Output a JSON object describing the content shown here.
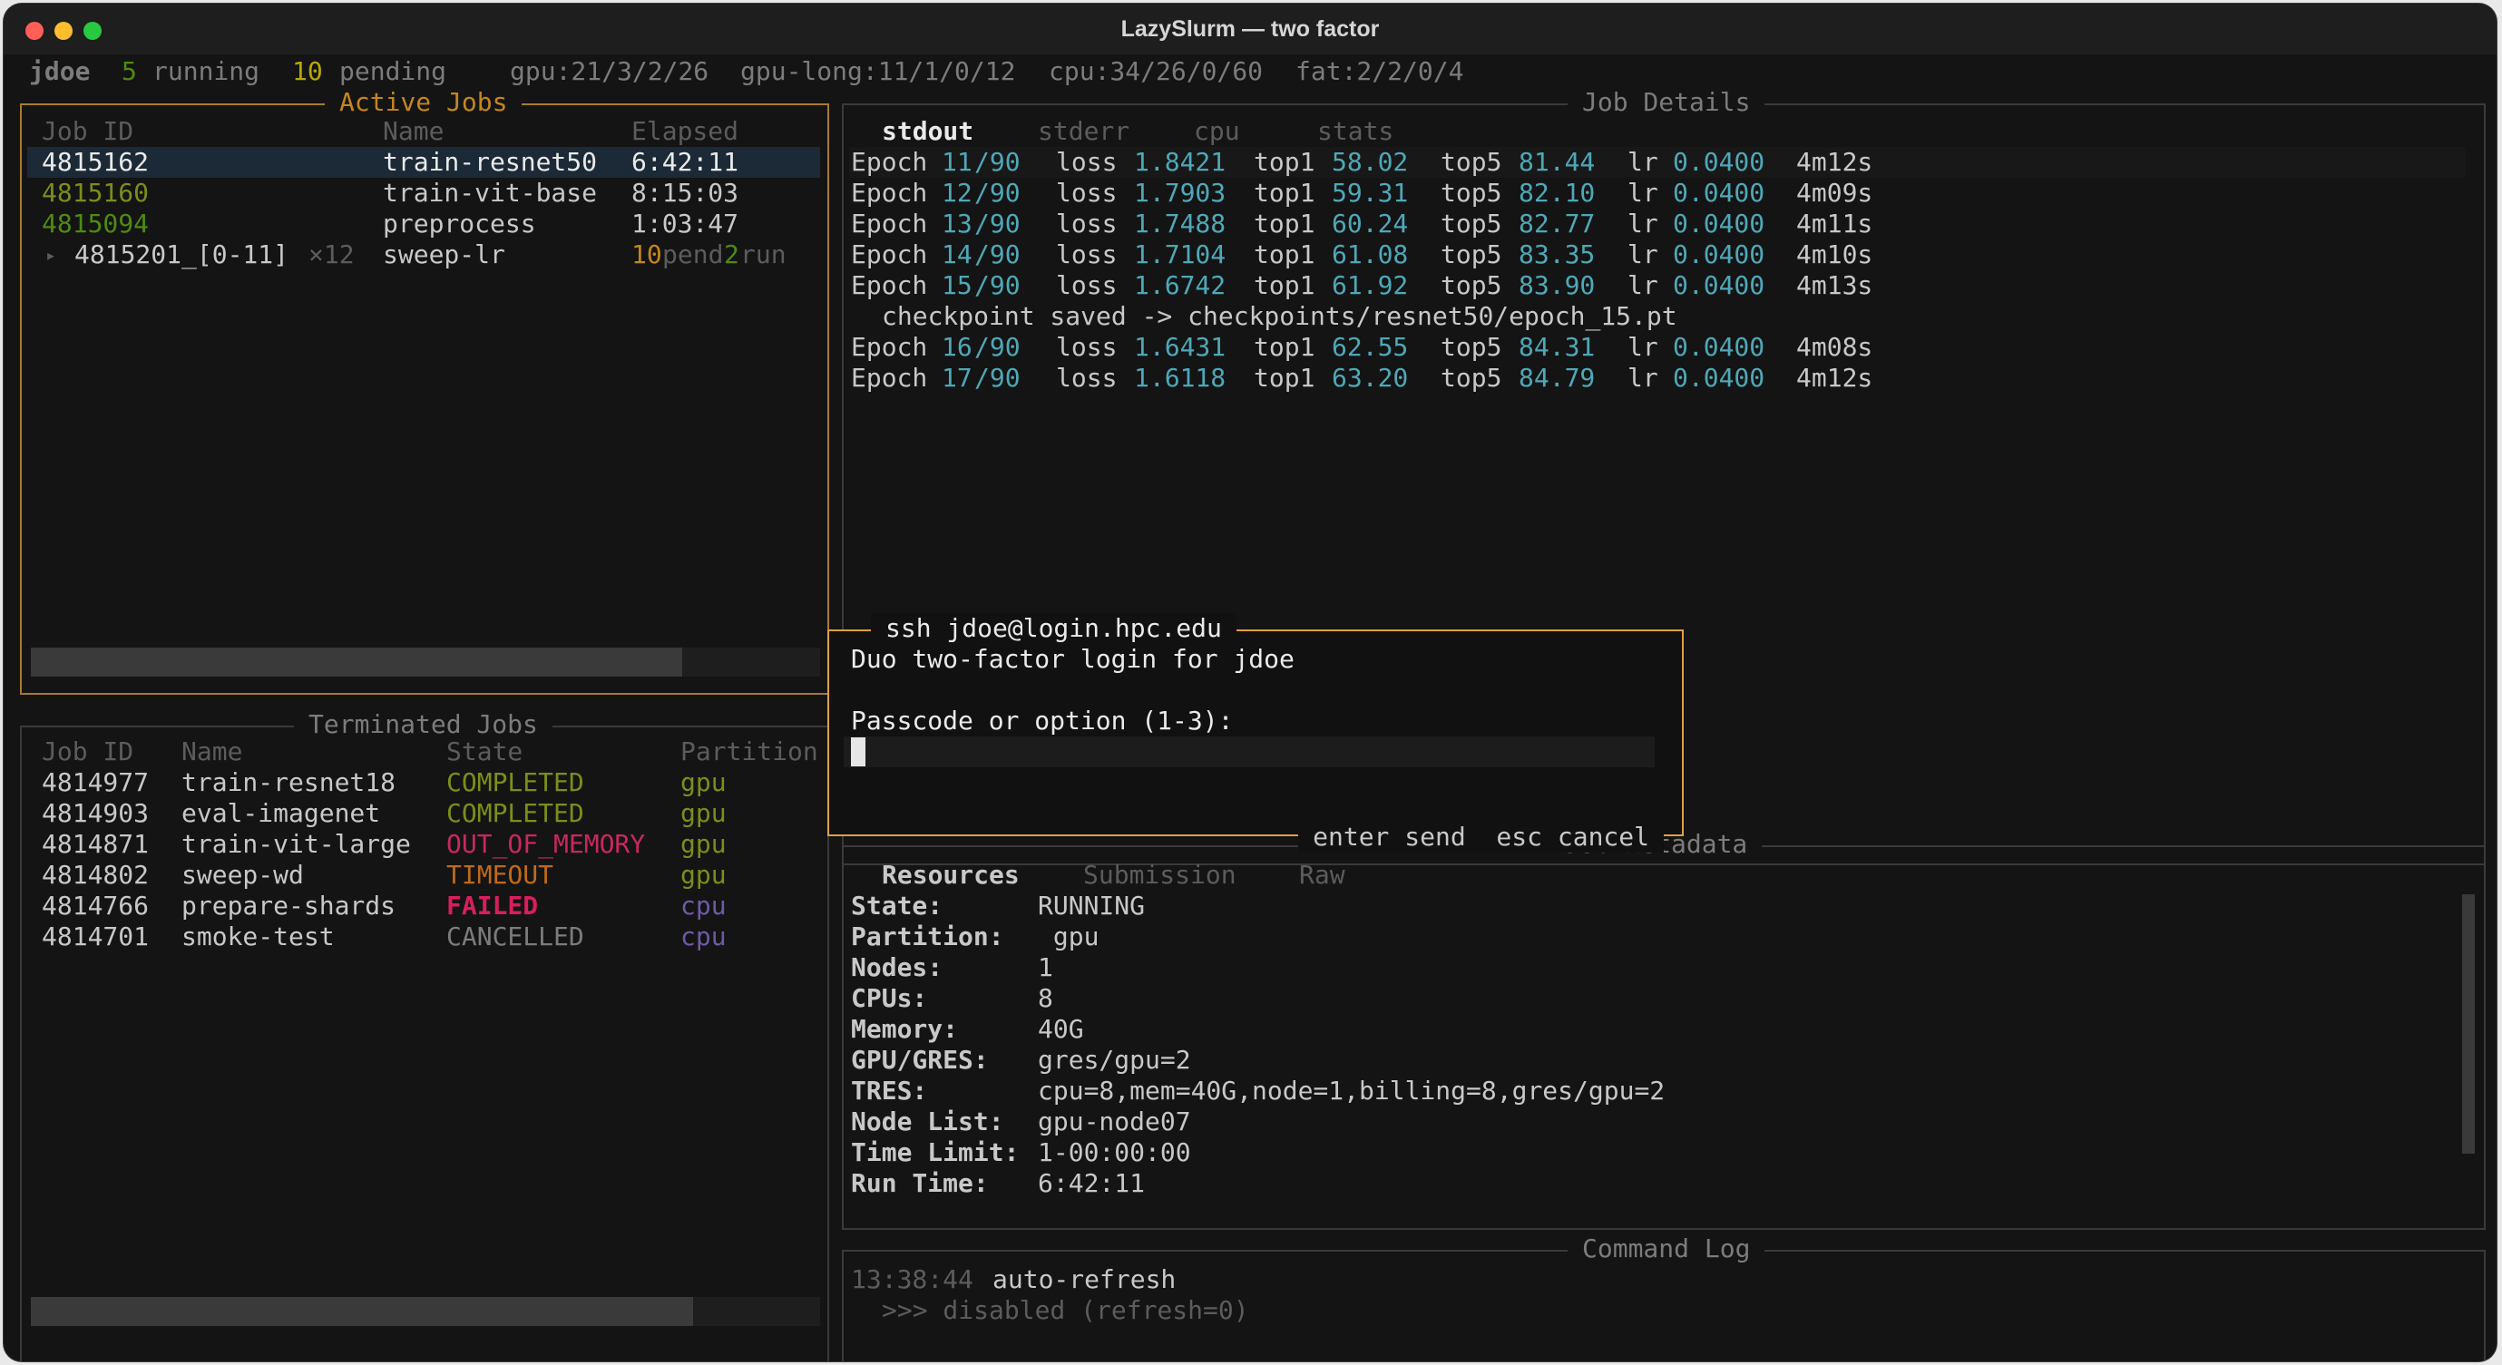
{
  "window": {
    "title": "LazySlurm — two factor"
  },
  "status": {
    "user": "jdoe",
    "running_count": "5",
    "running_label": "running",
    "pending_count": "10",
    "pending_label": "pending",
    "gpu": "gpu:21/3/2/26",
    "gpu_long": "gpu-long:11/1/0/12",
    "cpu": "cpu:34/26/0/60",
    "fat": "fat:2/2/0/4"
  },
  "active_jobs": {
    "title": "Active Jobs",
    "headers": {
      "id": "Job ID",
      "name": "Name",
      "elapsed": "Elapsed"
    },
    "rows": [
      {
        "id": "4815162",
        "name": "train-resnet50",
        "elapsed": "6:42:11"
      },
      {
        "id": "4815160",
        "name": "train-vit-base",
        "elapsed": "8:15:03"
      },
      {
        "id": "4815094",
        "name": "preprocess",
        "elapsed": "1:03:47"
      }
    ],
    "array_row": {
      "arrow": "▸",
      "id": "4815201_[0-11]",
      "count": "×12",
      "name": "sweep-lr",
      "pend_count": "10",
      "pend_label": "pend",
      "run_count": "2",
      "run_label": "run"
    }
  },
  "terminated_jobs": {
    "title": "Terminated Jobs",
    "headers": {
      "id": "Job ID",
      "name": "Name",
      "state": "State",
      "partition": "Partition"
    },
    "rows": [
      {
        "id": "4814977",
        "name": "train-resnet18",
        "state": "COMPLETED",
        "partition": "gpu"
      },
      {
        "id": "4814903",
        "name": "eval-imagenet",
        "state": "COMPLETED",
        "partition": "gpu"
      },
      {
        "id": "4814871",
        "name": "train-vit-large",
        "state": "OUT_OF_MEMORY",
        "partition": "gpu"
      },
      {
        "id": "4814802",
        "name": "sweep-wd",
        "state": "TIMEOUT",
        "partition": "gpu"
      },
      {
        "id": "4814766",
        "name": "prepare-shards",
        "state": "FAILED",
        "partition": "cpu"
      },
      {
        "id": "4814701",
        "name": "smoke-test",
        "state": "CANCELLED",
        "partition": "cpu"
      }
    ]
  },
  "job_details": {
    "title": "Job Details",
    "tabs": [
      "stdout",
      "stderr",
      "cpu",
      "stats"
    ],
    "labels": {
      "epoch": "Epoch",
      "loss": "loss",
      "top1": "top1",
      "top5": "top5",
      "lr": "lr"
    },
    "epochs_before": [
      {
        "epoch": "11",
        "total": "/90",
        "loss": "1.8421",
        "top1": "58.02",
        "top5": "81.44",
        "lr": "0.0400",
        "time": "4m12s"
      },
      {
        "epoch": "12",
        "total": "/90",
        "loss": "1.7903",
        "top1": "59.31",
        "top5": "82.10",
        "lr": "0.0400",
        "time": "4m09s"
      },
      {
        "epoch": "13",
        "total": "/90",
        "loss": "1.7488",
        "top1": "60.24",
        "top5": "82.77",
        "lr": "0.0400",
        "time": "4m11s"
      },
      {
        "epoch": "14",
        "total": "/90",
        "loss": "1.7104",
        "top1": "61.08",
        "top5": "83.35",
        "lr": "0.0400",
        "time": "4m10s"
      },
      {
        "epoch": "15",
        "total": "/90",
        "loss": "1.6742",
        "top1": "61.92",
        "top5": "83.90",
        "lr": "0.0400",
        "time": "4m13s"
      }
    ],
    "checkpoint": "checkpoint saved -> checkpoints/resnet50/epoch_15.pt",
    "epochs_after": [
      {
        "epoch": "16",
        "total": "/90",
        "loss": "1.6431",
        "top1": "62.55",
        "top5": "84.31",
        "lr": "0.0400",
        "time": "4m08s"
      },
      {
        "epoch": "17",
        "total": "/90",
        "loss": "1.6118",
        "top1": "63.20",
        "top5": "84.79",
        "lr": "0.0400",
        "time": "4m12s"
      }
    ]
  },
  "job_metadata": {
    "title": "Job Metadata",
    "tabs": [
      "Resources",
      "Submission",
      "Raw"
    ],
    "fields": [
      {
        "key": "State:",
        "value": "RUNNING"
      },
      {
        "key": "Partition:",
        "value": " gpu"
      },
      {
        "key": "Nodes:",
        "value": "1"
      },
      {
        "key": "CPUs:",
        "value": "8"
      },
      {
        "key": "Memory:",
        "value": "40G"
      },
      {
        "key": "GPU/GRES:",
        "value": "gres/gpu=2"
      },
      {
        "key": "TRES:",
        "value": "cpu=8,mem=40G,node=1,billing=8,gres/gpu=2"
      },
      {
        "key": "Node List:",
        "value": "gpu-node07"
      },
      {
        "key": "Time Limit:",
        "value": "1-00:00:00"
      },
      {
        "key": "Run Time:",
        "value": "6:42:11"
      }
    ]
  },
  "command_log": {
    "title": "Command Log",
    "time": "13:38:44",
    "message": "auto-refresh",
    "detail": ">>> disabled (refresh=0)"
  },
  "modal": {
    "title": "ssh jdoe@login.hpc.edu",
    "line1": "Duo two-factor login for jdoe",
    "prompt": "Passcode or option (1-3):",
    "input_value": "",
    "hint_enter": "enter send",
    "hint_esc": "esc cancel"
  },
  "colors": {
    "accent_border": "#e0a040",
    "selection_bg": "#1b2a36",
    "metric_value": "#4ea8b8",
    "completed": "#7a8f1a",
    "failed": "#d81e5c"
  }
}
